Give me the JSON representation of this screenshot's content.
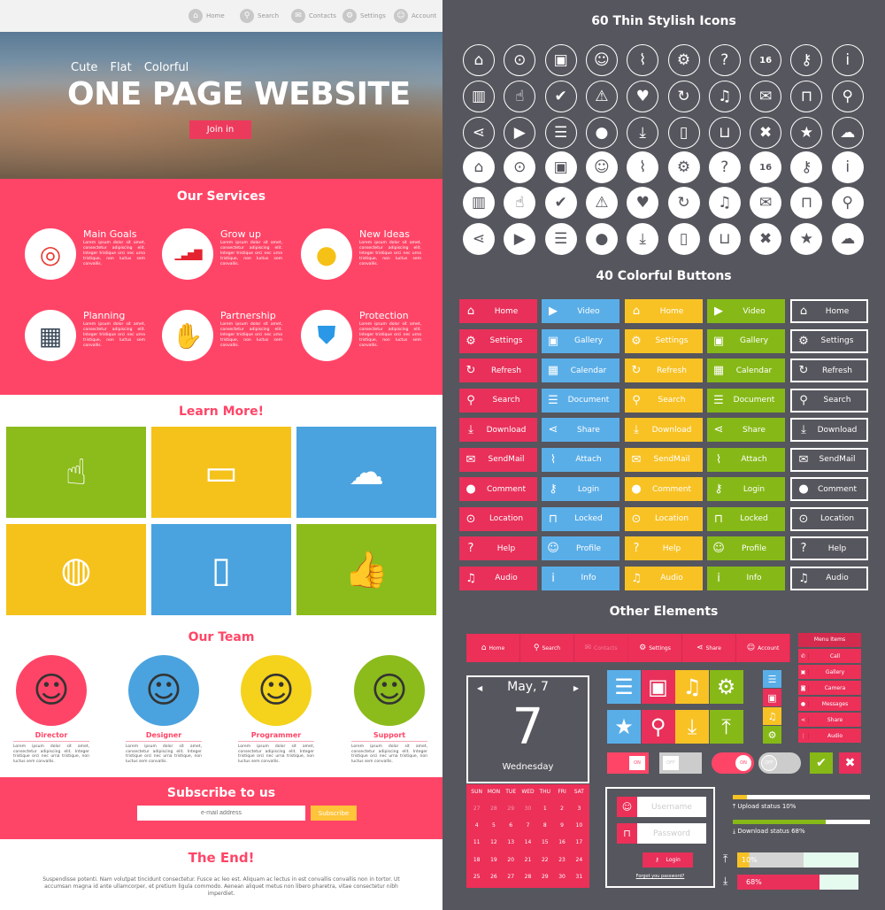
{
  "nav": [
    {
      "icon": "home-icon",
      "glyph": "⌂",
      "label": "Home"
    },
    {
      "icon": "search-icon",
      "glyph": "⚲",
      "label": "Search"
    },
    {
      "icon": "mail-icon",
      "glyph": "✉",
      "label": "Contacts"
    },
    {
      "icon": "gear-icon",
      "glyph": "⚙",
      "label": "Settings"
    },
    {
      "icon": "user-icon",
      "glyph": "☺",
      "label": "Account"
    }
  ],
  "hero": {
    "tagline": "Cute  Flat  Colorful",
    "title": "ONE PAGE WEBSITE",
    "button": "Join in"
  },
  "services": {
    "title": "Our Services",
    "items": [
      {
        "title": "Main Goals",
        "icon": "target-icon",
        "glyph": "◎",
        "color": "#e8372e",
        "text": "Lorem ipsum dolor sit amet, consectetur adipiscing elit. Integer tristique orci nec urna tristique, non luctus sem convallis."
      },
      {
        "title": "Grow up",
        "icon": "bar-chart-icon",
        "glyph": "▁▃▅▇",
        "color": "#e52330",
        "text": "Lorem ipsum dolor sit amet, consectetur adipiscing elit. Integer tristique orci nec urna tristique, non luctus sem convallis."
      },
      {
        "title": "New Ideas",
        "icon": "lightbulb-icon",
        "glyph": "●",
        "color": "#f6c117",
        "text": "Lorem ipsum dolor sit amet, consectetur adipiscing elit. Integer tristique orci nec urna tristique, non luctus sem convallis."
      },
      {
        "title": "Planning",
        "icon": "calendar-icon",
        "glyph": "▦",
        "color": "#3b4a5a",
        "text": "Lorem ipsum dolor sit amet, consectetur adipiscing elit. Integer tristique orci nec urna tristique, non luctus sem convallis."
      },
      {
        "title": "Partnership",
        "icon": "handshake-icon",
        "glyph": "✋",
        "color": "#e8b98a",
        "text": "Lorem ipsum dolor sit amet, consectetur adipiscing elit. Integer tristique orci nec urna tristique, non luctus sem convallis."
      },
      {
        "title": "Protection",
        "icon": "shield-icon",
        "glyph": "⛊",
        "color": "#2a98e6",
        "text": "Lorem ipsum dolor sit amet, consectetur adipiscing elit. Integer tristique orci nec urna tristique, non luctus sem convallis."
      }
    ]
  },
  "learn": {
    "title": "Learn More!",
    "tiles": [
      {
        "icon": "hands-with-devices-icon",
        "glyph": "☝",
        "color": "#8cbb1c"
      },
      {
        "icon": "devices-icon",
        "glyph": "▭",
        "color": "#f5c21b"
      },
      {
        "icon": "cloud-network-icon",
        "glyph": "☁",
        "color": "#4aa3df"
      },
      {
        "icon": "globe-icon",
        "glyph": "◍",
        "color": "#f5c21b"
      },
      {
        "icon": "phone-in-hands-icon",
        "glyph": "▯",
        "color": "#4aa3df"
      },
      {
        "icon": "thumbs-up-smartwatch-icon",
        "glyph": "👍",
        "color": "#8cbb1c"
      }
    ]
  },
  "team": {
    "title": "Our Team",
    "members": [
      {
        "name": "Director",
        "color": "#ff4567",
        "glyph": "☺",
        "text": "Lorem ipsum dolor sit amet, consectetur adipiscing elit. Integer tristique orci nec urna tristique, non luctus sem convallis."
      },
      {
        "name": "Designer",
        "color": "#4aa3df",
        "glyph": "☺",
        "text": "Lorem ipsum dolor sit amet, consectetur adipiscing elit. Integer tristique orci nec urna tristique, non luctus sem convallis."
      },
      {
        "name": "Programmer",
        "color": "#f5d21b",
        "glyph": "☺",
        "text": "Lorem ipsum dolor sit amet, consectetur adipiscing elit. Integer tristique orci nec urna tristique, non luctus sem convallis."
      },
      {
        "name": "Support",
        "color": "#8cbb1c",
        "glyph": "☺",
        "text": "Lorem ipsum dolor sit amet, consectetur adipiscing elit. Integer tristique orci nec urna tristique, non luctus sem convallis."
      }
    ]
  },
  "subscribe": {
    "title": "Subscribe to us",
    "placeholder": "e-mail address",
    "button": "Subscribe"
  },
  "end": {
    "title": "The End!",
    "text": "Suspendisse potenti. Nam volutpat tincidunt consectetur. Fusce ac leo est. Aliquam ac lectus in est convallis convallis non in tortor. Ut accumsan magna id ante ullamcorper, et pretium ligula commodo. Aenean aliquet metus non libero pharetra, vitae consectetur nibh imperdiet."
  },
  "icons_section": {
    "title": "60 Thin Stylish Icons",
    "icons": [
      [
        "home",
        "⌂"
      ],
      [
        "location-pin",
        "⊙"
      ],
      [
        "gallery",
        "▣"
      ],
      [
        "profile",
        "☺"
      ],
      [
        "paperclip",
        "⌇"
      ],
      [
        "gear",
        "⚙"
      ],
      [
        "question",
        "?"
      ],
      [
        "calendar",
        "16"
      ],
      [
        "key",
        "⚷"
      ],
      [
        "info",
        "i"
      ],
      [
        "trash",
        "▥"
      ],
      [
        "hand-pointer",
        "☝"
      ],
      [
        "check",
        "✔"
      ],
      [
        "warning",
        "⚠"
      ],
      [
        "heart",
        "♥"
      ],
      [
        "refresh",
        "↻"
      ],
      [
        "music",
        "♫"
      ],
      [
        "mail",
        "✉"
      ],
      [
        "lock",
        "⊓"
      ],
      [
        "search",
        "⚲"
      ],
      [
        "share",
        "⋖"
      ],
      [
        "video",
        "▶"
      ],
      [
        "document",
        "☰"
      ],
      [
        "chat",
        "●"
      ],
      [
        "download",
        "⤓"
      ],
      [
        "phone",
        "▯"
      ],
      [
        "basket",
        "⊔"
      ],
      [
        "close",
        "✖"
      ],
      [
        "star",
        "★"
      ],
      [
        "cloud",
        "☁"
      ]
    ]
  },
  "buttons_section": {
    "title": "40 Colorful  Buttons",
    "colors": [
      "#e8305a",
      "#5aaee8",
      "#f8c225",
      "#86b917",
      "outline"
    ],
    "set_a": [
      [
        "home",
        "⌂",
        "Home"
      ],
      [
        "settings",
        "⚙",
        "Settings"
      ],
      [
        "refresh",
        "↻",
        "Refresh"
      ],
      [
        "search",
        "⚲",
        "Search"
      ],
      [
        "download",
        "⤓",
        "Download"
      ],
      [
        "sendmail",
        "✉",
        "SendMail"
      ],
      [
        "comment",
        "●",
        "Comment"
      ],
      [
        "location",
        "⊙",
        "Location"
      ],
      [
        "help",
        "?",
        "Help"
      ],
      [
        "audio",
        "♫",
        "Audio"
      ]
    ],
    "set_b": [
      [
        "video",
        "▶",
        "Video"
      ],
      [
        "gallery",
        "▣",
        "Gallery"
      ],
      [
        "calendar",
        "▦",
        "Calendar"
      ],
      [
        "document",
        "☰",
        "Document"
      ],
      [
        "share",
        "⋖",
        "Share"
      ],
      [
        "attach",
        "⌇",
        "Attach"
      ],
      [
        "login",
        "⚷",
        "Login"
      ],
      [
        "locked",
        "⊓",
        "Locked"
      ],
      [
        "profile",
        "☺",
        "Profile"
      ],
      [
        "info",
        "i",
        "Info"
      ]
    ]
  },
  "other": {
    "title": "Other Elements",
    "navbar": [
      [
        "home",
        "⌂",
        "Home"
      ],
      [
        "search",
        "⚲",
        "Search"
      ],
      [
        "mail",
        "✉",
        "Contacts"
      ],
      [
        "gear",
        "⚙",
        "Settings"
      ],
      [
        "share",
        "⋖",
        "Share"
      ],
      [
        "user",
        "☺",
        "Account"
      ]
    ],
    "menu": {
      "title": "Menu Items",
      "items": [
        [
          "phone",
          "✆",
          "Call"
        ],
        [
          "gallery",
          "▣",
          "Gallery"
        ],
        [
          "camera",
          "◙",
          "Camera"
        ],
        [
          "chat",
          "●",
          "Messages"
        ],
        [
          "share",
          "⋖",
          "Share"
        ],
        [
          "microphone",
          "⋮",
          "Audio"
        ]
      ]
    },
    "calendar": {
      "month": "May, 7",
      "day": "7",
      "weekday": "Wednesday",
      "days": [
        "SUN",
        "MON",
        "TUE",
        "WED",
        "THU",
        "FRI",
        "SAT"
      ],
      "prev": [
        "27",
        "28",
        "29",
        "30"
      ],
      "dates": [
        "1",
        "2",
        "3",
        "4",
        "5",
        "6",
        "7",
        "8",
        "9",
        "10",
        "11",
        "12",
        "13",
        "14",
        "15",
        "16",
        "17",
        "18",
        "19",
        "20",
        "21",
        "22",
        "23",
        "24",
        "25",
        "26",
        "27",
        "28",
        "29",
        "30",
        "31"
      ]
    },
    "tiles": [
      [
        "document",
        "☰",
        "#5aaee8"
      ],
      [
        "gallery",
        "▣",
        "#e8305a"
      ],
      [
        "music",
        "♫",
        "#f8c225"
      ],
      [
        "gear",
        "⚙",
        "#86b917"
      ],
      [
        "star",
        "★",
        "#5aaee8"
      ],
      [
        "search",
        "⚲",
        "#e8305a"
      ],
      [
        "download",
        "⤓",
        "#f8c225"
      ],
      [
        "upload",
        "⤒",
        "#86b917"
      ]
    ],
    "small_tiles": [
      [
        "document",
        "☰",
        "#5aaee8"
      ],
      [
        "gallery",
        "▣",
        "#e8305a"
      ],
      [
        "music",
        "♫",
        "#f8c225"
      ],
      [
        "gear",
        "⚙",
        "#86b917"
      ]
    ],
    "toggles": {
      "on": "ON",
      "off": "OFF"
    },
    "login": {
      "username": "Username",
      "password": "Password",
      "button": "Login",
      "forgot": "Forgot you password?"
    },
    "upload": {
      "label": "Upload status 10%",
      "percent": 10,
      "text": "10%"
    },
    "download": {
      "label": "Download status 68%",
      "percent": 68,
      "text": "68%"
    }
  }
}
